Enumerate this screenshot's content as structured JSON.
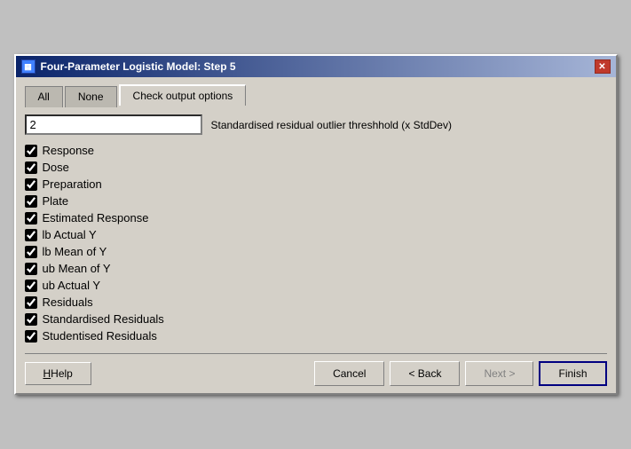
{
  "window": {
    "title": "Four-Parameter Logistic Model: Step 5",
    "icon": "chart-icon"
  },
  "tabs": [
    {
      "id": "all",
      "label": "All",
      "active": false
    },
    {
      "id": "none",
      "label": "None",
      "active": false
    },
    {
      "id": "check-output",
      "label": "Check output options",
      "active": true
    }
  ],
  "threshold": {
    "value": "2",
    "label": "Standardised residual outlier threshhold (x StdDev)"
  },
  "checkboxes": [
    {
      "id": "response",
      "label": "Response",
      "checked": true
    },
    {
      "id": "dose",
      "label": "Dose",
      "checked": true
    },
    {
      "id": "preparation",
      "label": "Preparation",
      "checked": true
    },
    {
      "id": "plate",
      "label": "Plate",
      "checked": true
    },
    {
      "id": "estimated-response",
      "label": "Estimated Response",
      "checked": true
    },
    {
      "id": "lb-actual-y",
      "label": "lb Actual Y",
      "checked": true
    },
    {
      "id": "lb-mean-of-y",
      "label": "lb Mean of Y",
      "checked": true
    },
    {
      "id": "ub-mean-of-y",
      "label": "ub Mean of Y",
      "checked": true
    },
    {
      "id": "ub-actual-y",
      "label": "ub Actual Y",
      "checked": true
    },
    {
      "id": "residuals",
      "label": "Residuals",
      "checked": true
    },
    {
      "id": "standardised-residuals",
      "label": "Standardised Residuals",
      "checked": true
    },
    {
      "id": "studentised-residuals",
      "label": "Studentised Residuals",
      "checked": true
    }
  ],
  "buttons": {
    "help": "Help",
    "cancel": "Cancel",
    "back": "< Back",
    "next": "Next >",
    "finish": "Finish"
  }
}
